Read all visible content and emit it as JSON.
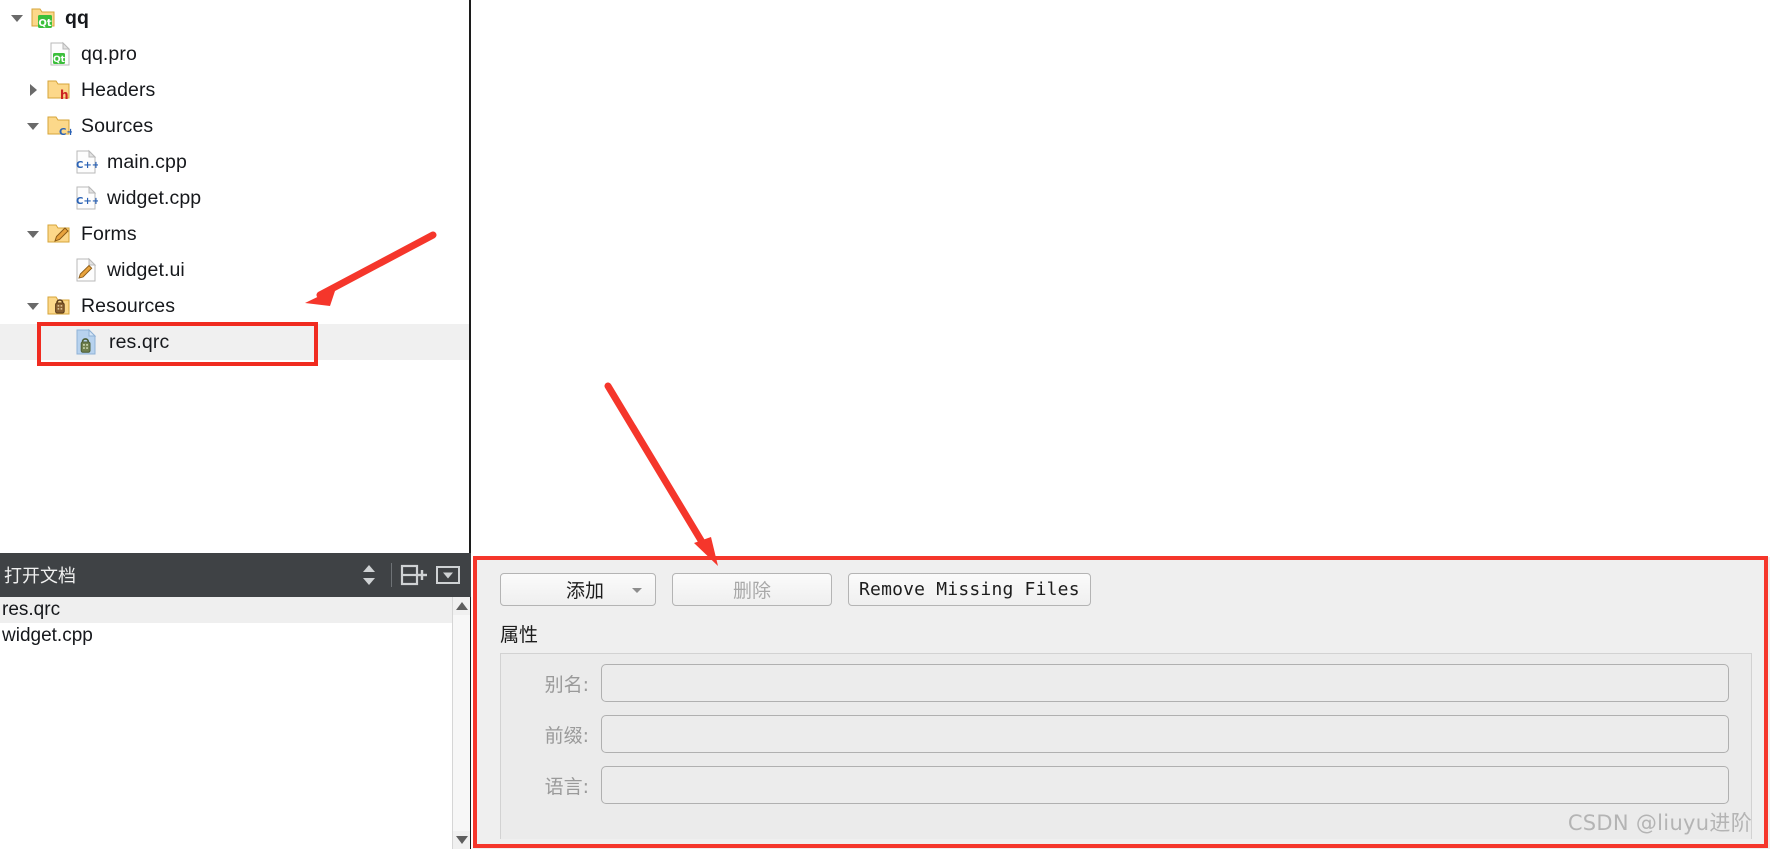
{
  "colors": {
    "annotation_red": "#f5362b",
    "panel_bg": "#efefef",
    "dark_header": "#3f4245",
    "selection": "#f0f0f0",
    "text": "#16181c",
    "disabled_text": "#a9a9a9",
    "watermark": "#b4b4b4"
  },
  "project_tree": {
    "nodes": [
      {
        "label": "qq",
        "icon": "qt-project-folder-icon",
        "indent": 0,
        "twisty": "down",
        "bold": true,
        "selected": false
      },
      {
        "label": "qq.pro",
        "icon": "qt-pro-file-icon",
        "indent": 1,
        "twisty": "none",
        "bold": false,
        "selected": false
      },
      {
        "label": "Headers",
        "icon": "headers-folder-icon",
        "indent": 1,
        "twisty": "right",
        "bold": false,
        "selected": false
      },
      {
        "label": "Sources",
        "icon": "sources-folder-icon",
        "indent": 1,
        "twisty": "down",
        "bold": false,
        "selected": false
      },
      {
        "label": "main.cpp",
        "icon": "cpp-file-icon",
        "indent": 2,
        "twisty": "none",
        "bold": false,
        "selected": false
      },
      {
        "label": "widget.cpp",
        "icon": "cpp-file-icon",
        "indent": 2,
        "twisty": "none",
        "bold": false,
        "selected": false
      },
      {
        "label": "Forms",
        "icon": "forms-folder-icon",
        "indent": 1,
        "twisty": "down",
        "bold": false,
        "selected": false
      },
      {
        "label": "widget.ui",
        "icon": "ui-file-icon",
        "indent": 2,
        "twisty": "none",
        "bold": false,
        "selected": false
      },
      {
        "label": "Resources",
        "icon": "resources-folder-icon",
        "indent": 1,
        "twisty": "down",
        "bold": false,
        "selected": false
      },
      {
        "label": "res.qrc",
        "icon": "qrc-file-icon",
        "indent": 2,
        "twisty": "none",
        "bold": false,
        "selected": true
      }
    ]
  },
  "open_documents": {
    "title": "打开文档",
    "toolbar": [
      {
        "name": "split-selector-icon",
        "glyph": "updown-arrows"
      },
      {
        "name": "split-add-icon",
        "glyph": "split-plus"
      },
      {
        "name": "close-dropdown-icon",
        "glyph": "boxed-chevron-down"
      }
    ],
    "items": [
      {
        "label": "res.qrc",
        "selected": true
      },
      {
        "label": "widget.cpp",
        "selected": false
      }
    ]
  },
  "qrc_editor": {
    "toolbar": {
      "add_label": "添加",
      "add_has_dropdown": true,
      "delete_label": "删除",
      "delete_disabled": true,
      "remove_missing_label": "Remove Missing Files"
    },
    "properties": {
      "section_title": "属性",
      "fields": [
        {
          "label": "别名:",
          "value": "",
          "placeholder": ""
        },
        {
          "label": "前缀:",
          "value": "",
          "placeholder": ""
        },
        {
          "label": "语言:",
          "value": "",
          "placeholder": ""
        }
      ]
    }
  },
  "watermark": {
    "text": "CSDN @liuyu进阶"
  }
}
